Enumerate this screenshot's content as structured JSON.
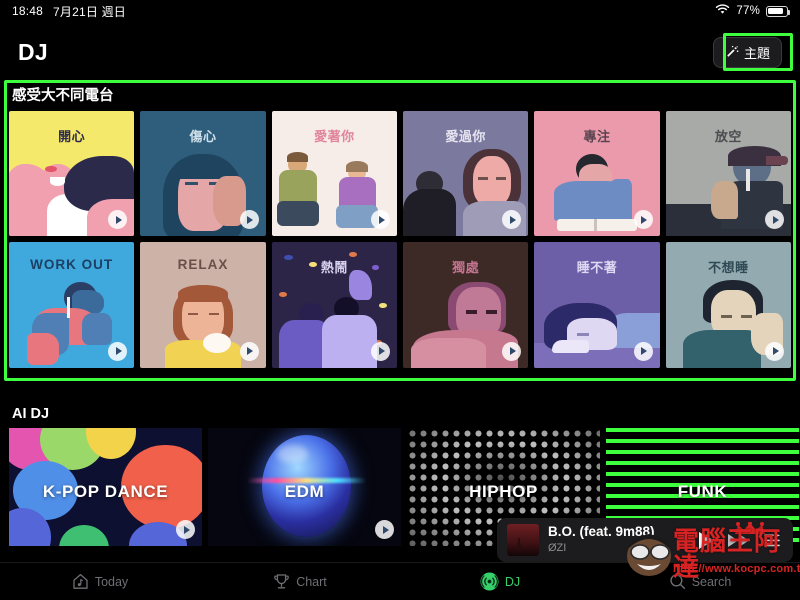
{
  "status_bar": {
    "time": "18:48",
    "date": "7月21日 週日",
    "wifi_icon": "wifi-icon",
    "battery_percent": "77%",
    "battery_icon": "battery-icon"
  },
  "header": {
    "title": "DJ",
    "theme_button": {
      "label": "主題",
      "icon": "magic-wand-icon"
    }
  },
  "annotations": {
    "accent_color": "#3dff3d",
    "boxes": [
      "theme-button-highlight",
      "mood-radio-section-highlight"
    ]
  },
  "radio_section": {
    "title": "感受大不同電台",
    "tiles": [
      {
        "label": "開心",
        "bg": "#f5e96b",
        "text_color": "#2b2a4a",
        "art": "happy"
      },
      {
        "label": "傷心",
        "bg": "#2f5d7c",
        "text_color": "#cfe0ea",
        "art": "sad"
      },
      {
        "label": "愛著你",
        "bg": "#f6ece8",
        "text_color": "#e2849a",
        "art": "loving"
      },
      {
        "label": "愛過你",
        "bg": "#7b7a9e",
        "text_color": "#e6e4f0",
        "art": "loved"
      },
      {
        "label": "專注",
        "bg": "#eb9aac",
        "text_color": "#5b4450",
        "art": "focus"
      },
      {
        "label": "放空",
        "bg": "#a8aaa8",
        "text_color": "#4a4c4f",
        "art": "chill"
      },
      {
        "label": "WORK OUT",
        "bg": "#3fa9dd",
        "text_color": "#1c3f63",
        "art": "workout"
      },
      {
        "label": "RELAX",
        "bg": "#cdb2a8",
        "text_color": "#6a4f49",
        "art": "relax"
      },
      {
        "label": "熱鬧",
        "bg": "#2d2547",
        "text_color": "#d8d3ef",
        "art": "party"
      },
      {
        "label": "獨處",
        "bg": "#3d2a26",
        "text_color": "#c2738f",
        "art": "alone"
      },
      {
        "label": "睡不著",
        "bg": "#6c5fa8",
        "text_color": "#ded9f2",
        "art": "insomnia"
      },
      {
        "label": "不想睡",
        "bg": "#93aab0",
        "text_color": "#2f4a55",
        "art": "nosleep"
      }
    ],
    "play_icon": "play-icon"
  },
  "ai_dj_section": {
    "title": "AI DJ",
    "tiles": [
      {
        "label": "K-POP DANCE",
        "art": "blobs"
      },
      {
        "label": "EDM",
        "art": "sphere"
      },
      {
        "label": "HIPHOP",
        "art": "dots"
      },
      {
        "label": "FUNK",
        "art": "lines"
      }
    ],
    "play_icon": "play-icon"
  },
  "mini_player": {
    "track": "B.O. (feat. 9m88)",
    "artist": "ØZI",
    "artwork": "album-art",
    "play_icon": "play-icon",
    "next_icon": "fast-forward-icon",
    "queue_icon": "queue-list-icon"
  },
  "tab_bar": {
    "active": "DJ",
    "active_color": "#35d06a",
    "tabs": [
      {
        "label": "Today",
        "icon": "home-note-icon"
      },
      {
        "label": "Chart",
        "icon": "trophy-icon"
      },
      {
        "label": "DJ",
        "icon": "broadcast-icon"
      },
      {
        "label": "Search",
        "icon": "search-icon"
      }
    ]
  },
  "watermark": {
    "text": "電腦王阿達",
    "url": "http://www.kocpc.com.tw",
    "color": "#d72323"
  }
}
